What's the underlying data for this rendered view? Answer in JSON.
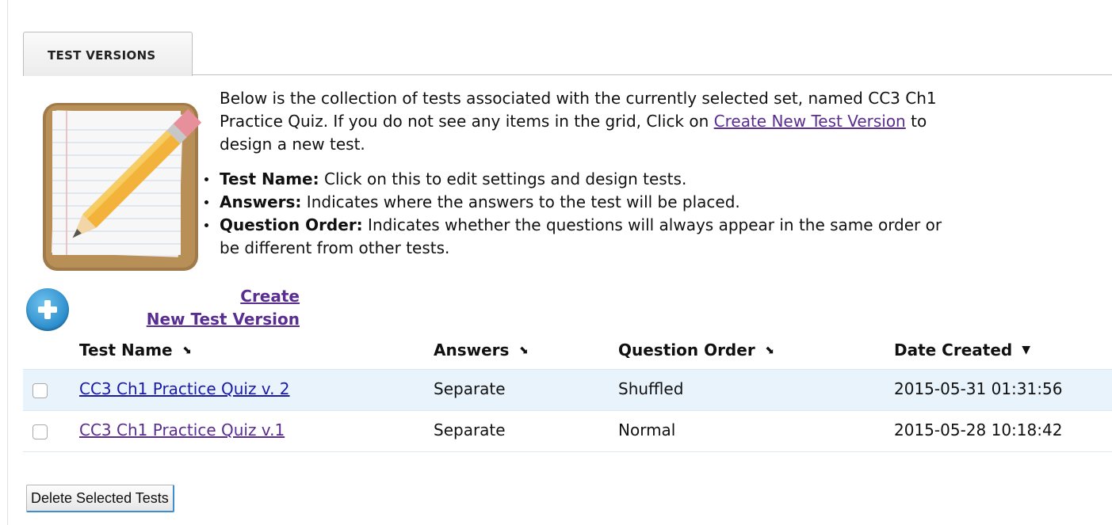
{
  "tab": {
    "label": "TEST VERSIONS"
  },
  "intro": {
    "text_before": "Below is the collection of tests associated with the currently selected set, named CC3 Ch1 Practice Quiz. If you do not see any items in the grid, Click on ",
    "link": "Create New Test Version",
    "text_after": " to design a new test."
  },
  "bullets": [
    {
      "term": "Test Name:",
      "desc": " Click on this to edit settings and design tests."
    },
    {
      "term": "Answers:",
      "desc": " Indicates where the answers to the test will be placed."
    },
    {
      "term": "Question Order:",
      "desc": " Indicates whether the questions will always appear in the same order or be different from other tests."
    }
  ],
  "create": {
    "line1": "Create",
    "line2": "New Test Version"
  },
  "icons": {
    "create": "plus-circle-icon",
    "sort_neutral": "sort-icon",
    "sort_desc": "sort-desc-icon"
  },
  "colors": {
    "link_visited": "#5a2d91",
    "link": "#1a1aa6",
    "accent": "#2a8ccc",
    "row_alt": "#e8f3fb"
  },
  "grid": {
    "headers": {
      "test_name": "Test Name",
      "answers": "Answers",
      "question_order": "Question Order",
      "date_created": "Date Created"
    },
    "sort_glyphs": {
      "neutral": "⬊",
      "desc": "▼"
    },
    "rows": [
      {
        "name": "CC3 Ch1 Practice Quiz v. 2",
        "answers": "Separate",
        "order": "Shuffled",
        "date": "2015-05-31 01:31:56",
        "checked": false,
        "link_color": "#1a1aa6"
      },
      {
        "name": "CC3 Ch1 Practice Quiz v.1",
        "answers": "Separate",
        "order": "Normal",
        "date": "2015-05-28 10:18:42",
        "checked": false,
        "link_color": "#5a2d91"
      }
    ]
  },
  "actions": {
    "delete_label": "Delete Selected Tests"
  }
}
